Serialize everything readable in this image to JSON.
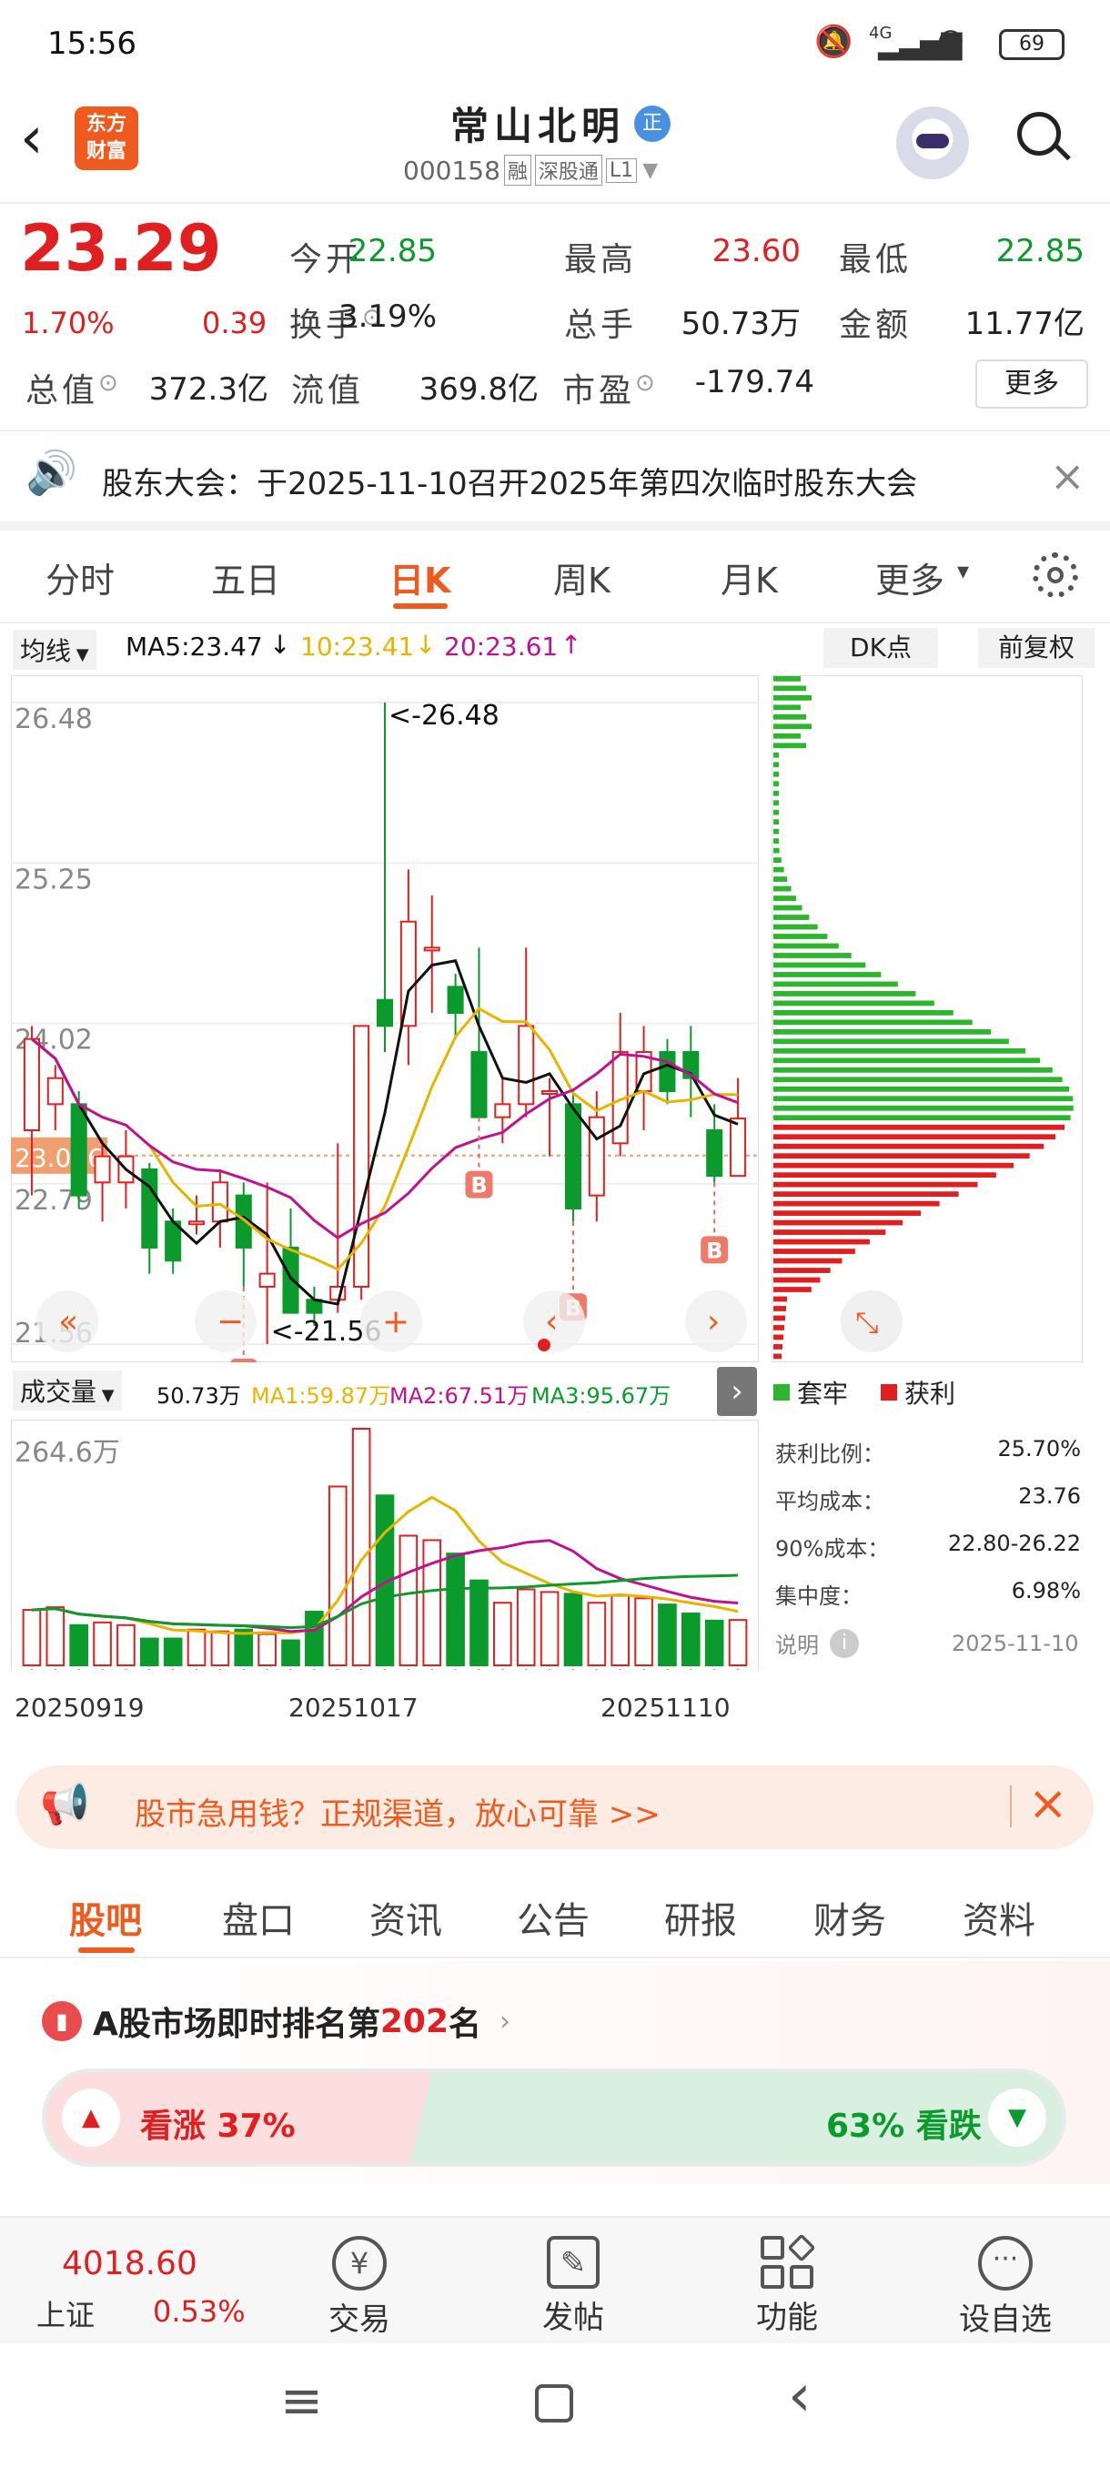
{
  "status_bar": {
    "time": "15:56",
    "battery": "69",
    "network": "4G"
  },
  "header": {
    "logo": "东方\n财富",
    "title": "常山北明",
    "badge": "正",
    "code": "000158",
    "tags": [
      "融",
      "深股通",
      "L1"
    ]
  },
  "quote": {
    "price": "23.29",
    "change_pct": "1.70%",
    "change": "0.39",
    "fields": [
      {
        "label": "今开",
        "value": "22.85",
        "color": "green"
      },
      {
        "label": "最高",
        "value": "23.60",
        "color": "red"
      },
      {
        "label": "最低",
        "value": "22.85",
        "color": "green"
      },
      {
        "label": "换手",
        "value": "3.19%",
        "color": "dark"
      },
      {
        "label": "总手",
        "value": "50.73万",
        "color": "dark"
      },
      {
        "label": "金额",
        "value": "11.77亿",
        "color": "dark"
      },
      {
        "label": "总值",
        "value": "372.3亿",
        "color": "dark"
      },
      {
        "label": "流值",
        "value": "369.8亿",
        "color": "dark"
      },
      {
        "label": "市盈",
        "value": "-179.74",
        "color": "dark"
      }
    ],
    "more_button": "更多"
  },
  "notice": {
    "text": "股东大会：于2025-11-10召开2025年第四次临时股东大会"
  },
  "chart_tabs": {
    "items": [
      "分时",
      "五日",
      "日K",
      "周K",
      "月K",
      "更多"
    ],
    "active": 2
  },
  "ma_bar": {
    "selector": "均线",
    "ma5": "MA5:23.47",
    "ma10": "10:23.41",
    "ma20": "20:23.61",
    "dk": "DK点",
    "adjust": "前复权"
  },
  "chart_data": {
    "type": "candlestick",
    "y_ticks": [
      "26.48",
      "25.25",
      "24.02",
      "22.79",
      "21.56"
    ],
    "ylim": [
      21.56,
      26.48
    ],
    "marker_price": "23.006",
    "high_label": "<-26.48",
    "low_label": "<-21.56",
    "buy_marker": "B",
    "candles": [
      {
        "o": 23.2,
        "h": 24.0,
        "l": 22.7,
        "c": 23.9
      },
      {
        "o": 23.4,
        "h": 23.7,
        "l": 23.2,
        "c": 23.6
      },
      {
        "o": 23.4,
        "h": 23.5,
        "l": 22.6,
        "c": 22.7
      },
      {
        "o": 22.8,
        "h": 23.1,
        "l": 22.5,
        "c": 23.0
      },
      {
        "o": 22.8,
        "h": 23.2,
        "l": 22.6,
        "c": 23.0
      },
      {
        "o": 22.9,
        "h": 22.95,
        "l": 22.1,
        "c": 22.3
      },
      {
        "o": 22.5,
        "h": 22.6,
        "l": 22.1,
        "c": 22.2
      },
      {
        "o": 22.5,
        "h": 22.7,
        "l": 22.4,
        "c": 22.5
      },
      {
        "o": 22.5,
        "h": 22.9,
        "l": 22.3,
        "c": 22.8
      },
      {
        "o": 22.7,
        "h": 22.8,
        "l": 22.0,
        "c": 22.3
      },
      {
        "o": 22.0,
        "h": 22.8,
        "l": 21.56,
        "c": 22.1
      },
      {
        "o": 22.3,
        "h": 22.6,
        "l": 21.8,
        "c": 21.8
      },
      {
        "o": 21.9,
        "h": 22.0,
        "l": 21.7,
        "c": 21.8
      },
      {
        "o": 21.9,
        "h": 23.1,
        "l": 21.8,
        "c": 22.0
      },
      {
        "o": 22.0,
        "h": 24.0,
        "l": 21.9,
        "c": 24.0
      },
      {
        "o": 24.2,
        "h": 26.48,
        "l": 23.8,
        "c": 24.0
      },
      {
        "o": 24.0,
        "h": 25.2,
        "l": 23.7,
        "c": 24.8
      },
      {
        "o": 24.6,
        "h": 25.0,
        "l": 24.1,
        "c": 24.6
      },
      {
        "o": 24.3,
        "h": 24.4,
        "l": 23.9,
        "c": 24.1
      },
      {
        "o": 23.8,
        "h": 24.6,
        "l": 23.3,
        "c": 23.3
      },
      {
        "o": 23.3,
        "h": 23.6,
        "l": 23.1,
        "c": 23.4
      },
      {
        "o": 23.4,
        "h": 24.6,
        "l": 23.3,
        "c": 24.0
      },
      {
        "o": 23.5,
        "h": 23.6,
        "l": 23.0,
        "c": 23.5
      },
      {
        "o": 23.4,
        "h": 23.5,
        "l": 22.5,
        "c": 22.6
      },
      {
        "o": 22.7,
        "h": 23.5,
        "l": 22.5,
        "c": 23.3
      },
      {
        "o": 23.1,
        "h": 24.1,
        "l": 23.0,
        "c": 23.8
      },
      {
        "o": 23.5,
        "h": 24.0,
        "l": 23.2,
        "c": 23.8
      },
      {
        "o": 23.8,
        "h": 23.9,
        "l": 23.4,
        "c": 23.5
      },
      {
        "o": 23.8,
        "h": 24.0,
        "l": 23.3,
        "c": 23.6
      },
      {
        "o": 23.2,
        "h": 23.4,
        "l": 22.8,
        "c": 22.85
      },
      {
        "o": 22.85,
        "h": 23.6,
        "l": 22.85,
        "c": 23.29
      }
    ],
    "volume": {
      "selector": "成交量",
      "vol_label": "50.73万",
      "ma1": "MA1:59.87万",
      "ma2": "MA2:67.51万",
      "ma3": "MA3:95.67万",
      "max_label": "264.6万",
      "ymax": 264.6,
      "values": [
        62,
        65,
        45,
        48,
        45,
        30,
        30,
        40,
        38,
        40,
        35,
        28,
        60,
        200,
        264.6,
        190,
        145,
        140,
        125,
        95,
        70,
        85,
        82,
        80,
        70,
        78,
        75,
        68,
        58,
        50,
        50.73
      ]
    },
    "x_labels": [
      "20250919",
      "20251017",
      "20251110"
    ]
  },
  "chip": {
    "legend_loss": "套牢",
    "legend_profit": "获利",
    "rows": [
      {
        "label": "获利比例：",
        "value": "25.70%"
      },
      {
        "label": "平均成本：",
        "value": "23.76"
      },
      {
        "label": "90%成本：",
        "value": "22.80-26.22"
      },
      {
        "label": "集中度：",
        "value": "6.98%"
      }
    ],
    "note": "说明",
    "date": "2025-11-10"
  },
  "ad": {
    "text": "股市急用钱？正规渠道，放心可靠 >>"
  },
  "sub_tabs": {
    "items": [
      "股吧",
      "盘口",
      "资讯",
      "公告",
      "研报",
      "财务",
      "资料"
    ],
    "active": 0
  },
  "rank": {
    "text_prefix": "A股市场即时排名第",
    "rank": "202",
    "text_suffix": "名",
    "up_label": "看涨 37%",
    "down_label": "63% 看跌",
    "up_pct": 37
  },
  "bottom_nav": {
    "index_value": "4018.60",
    "index_name": "上证",
    "index_change": "0.53%",
    "items": [
      "交易",
      "发帖",
      "功能",
      "设自选"
    ]
  }
}
